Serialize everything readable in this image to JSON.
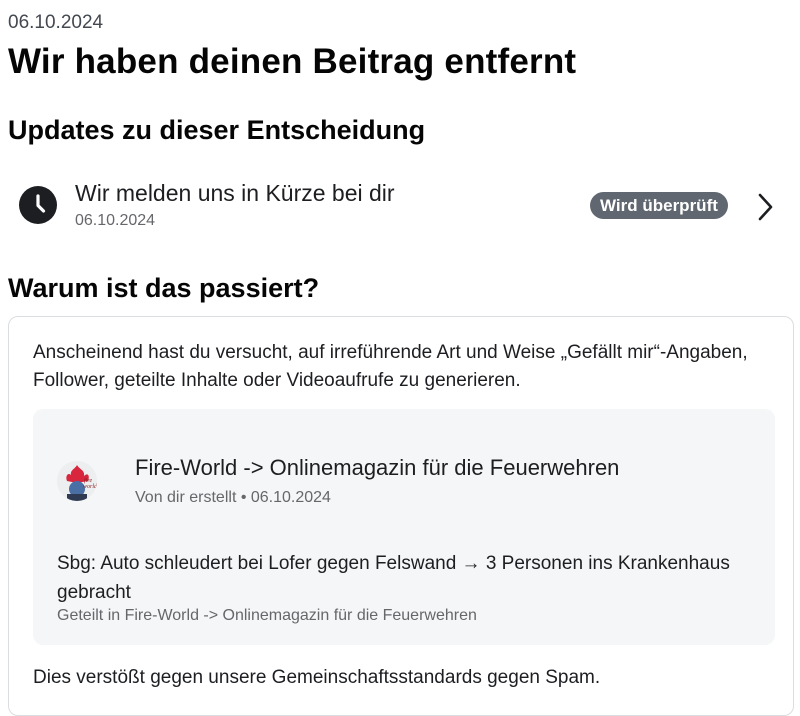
{
  "header": {
    "date": "06.10.2024",
    "title": "Wir haben deinen Beitrag entfernt"
  },
  "updates": {
    "section_title": "Updates zu dieser Entscheidung",
    "item": {
      "icon": "clock-icon",
      "label": "Wir melden uns in Kürze bei dir",
      "date": "06.10.2024",
      "status_badge": "Wird überprüft"
    }
  },
  "reason": {
    "section_title": "Warum ist das passiert?",
    "description": "Anscheinend hast du versucht, auf irreführende Art und Weise „Gefällt mir“-Angaben, Follower, geteilte Inhalte oder Videoaufrufe zu generieren.",
    "post": {
      "page_name": "Fire-World -> Onlinemagazin für die Feuerwehren",
      "meta": "Von dir erstellt • 06.10.2024",
      "text": "Sbg: Auto schleudert bei Lofer gegen Felswand → 3 Personen ins Krankenhaus gebracht",
      "shared_in": "Geteilt in Fire-World -> Onlinemagazin für die Feuerwehren",
      "avatar_logo_text": "fire world"
    },
    "policy_text": "Dies verstößt gegen unsere Gemeinschaftsstandards gegen Spam."
  },
  "colors": {
    "text_primary": "#1c1e21",
    "text_secondary": "#65676b",
    "badge_bg": "#606770",
    "post_bg": "#f5f6f7",
    "card_border": "#dadde1"
  }
}
